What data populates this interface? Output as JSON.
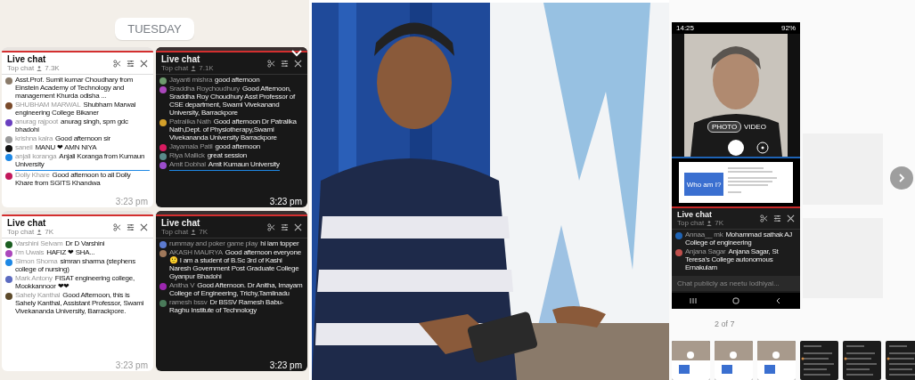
{
  "date_chip": "TUESDAY",
  "chat_screenshots": [
    {
      "dark": false,
      "title": "Live chat",
      "subtitle": "Top chat",
      "viewers": "7.3K",
      "time": "3:23 pm",
      "collapse_button": false,
      "messages": [
        {
          "text": "Asst.Prof. Sumit kumar Choudhary from Einstein Academy of Technology and management Khurda odisha ...",
          "color": "#8a7b6a",
          "underlined": false
        },
        {
          "author": "SHUBHAM MARWAL",
          "text": "Shubham Marwal engineering College Bikaner",
          "color": "#7a4a2a",
          "underlined": false
        },
        {
          "author": "anurag rajpoot",
          "text": "anurag singh, spm gdc bhadohi",
          "color": "#6a3fc0",
          "underlined": false
        },
        {
          "author": "krishna kalra",
          "text": "Good afternoon sir",
          "color": "#9a9a9a",
          "underlined": false
        },
        {
          "author": "saneil",
          "text": "MANU ❤ AMN NIYA",
          "color": "#111111",
          "underlined": false
        },
        {
          "author": "anjali koranga",
          "text": "Anjali Koranga from Kumaun University",
          "color": "#1e88e5",
          "underlined": true
        },
        {
          "author": "Dolly Khare",
          "text": "Good afternoon to all Dolly Khare from SGITS Khandwa",
          "color": "#c2185b",
          "underlined": false
        }
      ]
    },
    {
      "dark": true,
      "title": "Live chat",
      "subtitle": "Top chat",
      "viewers": "7.1K",
      "time": "3:23 pm",
      "collapse_button": true,
      "messages": [
        {
          "author": "Jayanti mishra",
          "text": "good afternoon",
          "color": "#6d9a6d",
          "underlined": false
        },
        {
          "author": "Sraddha Roychoudhury",
          "text": "Good Afternoon, Sraddha Roy Choudhury Asst Professor of CSE department, Swami Vivekanand University, Barrackpore",
          "color": "#ab47bc",
          "underlined": false
        },
        {
          "author": "Patralika Nath",
          "text": "Good afternoon Dr Patralika Nath,Dept. of Physiotherapy,Swami Vivekananda University Barrackpore",
          "color": "#d4a02a",
          "underlined": false
        },
        {
          "author": "Jayamala Patil",
          "text": "good afternoon",
          "color": "#d81b60",
          "underlined": false
        },
        {
          "author": "Riya Mallick",
          "text": "great session",
          "color": "#5a8a8a",
          "underlined": false
        },
        {
          "author": "Amit Dobhal",
          "text": "Amit Kumaun University",
          "color": "#9c4dcc",
          "underlined": true
        }
      ]
    },
    {
      "dark": false,
      "title": "Live chat",
      "subtitle": "Top chat",
      "viewers": "7K",
      "time": "3:23 pm",
      "collapse_button": false,
      "messages": [
        {
          "author": "Varshini Selvam",
          "text": "Dr D Varshini",
          "color": "#1b5e20",
          "underlined": false
        },
        {
          "author": "I'm Uwais",
          "text": "HAFIZ ❤ SHA...",
          "color": "#ab47bc",
          "underlined": false
        },
        {
          "author": "Simon Shoma",
          "text": "simran sharma (stephens college of nursing)",
          "color": "#1e88e5",
          "underlined": false
        },
        {
          "author": "Mark Antony",
          "text": "FISAT engineering college, Mookkannoor ❤❤",
          "color": "#5c6bc0",
          "underlined": false
        },
        {
          "author": "Sahely Kanthal",
          "text": "Good Afternoon, this is Sahely Kanthal, Assistant Professor, Swami Vivekananda University, Barrackpore.",
          "color": "#5d4a2a",
          "underlined": false
        }
      ]
    },
    {
      "dark": true,
      "title": "Live chat",
      "subtitle": "Top chat",
      "viewers": "7K",
      "time": "3:23 pm",
      "collapse_button": false,
      "messages": [
        {
          "author": "rummay and poker game play",
          "text": "hi iam topper",
          "color": "#5c7bd0",
          "underlined": false
        },
        {
          "author": "AKASH MAURYA",
          "text": "Good afternoon everyone 🙂 I am a student of B.Sc 3rd of Kashi Naresh Government Post Graduate College Gyanpur Bhadohi",
          "color": "#a0785a",
          "underlined": false
        },
        {
          "author": "Anitha V",
          "text": "Good Afternoon. Dr Anitha, Imayam College of Engineering, Trichy,Tamilnadu",
          "color": "#9c27b0",
          "underlined": false
        },
        {
          "author": "ramesh bssv",
          "text": "Dr BSSV Ramesh Babu- Raghu Institute of Technology",
          "color": "#4a7a5a",
          "underlined": false
        }
      ]
    }
  ],
  "viewer": {
    "phone": {
      "clock": "14:25",
      "battery": "92%",
      "camera_modes": [
        {
          "label": "PHOTO",
          "selected": true
        },
        {
          "label": "VIDEO",
          "selected": false
        }
      ],
      "slide_title": "Who am I?",
      "chat": {
        "title": "Live chat",
        "subtitle": "Top chat",
        "viewers": "7K",
        "messages": [
          {
            "author": "Annaa__ mk",
            "text": "Mohammad sathak AJ College of engineering",
            "color": "#1e63b5"
          },
          {
            "author": "Anjana Sagar",
            "text": "Anjana Sagar, St Teresa's College autonomous Ernakulam",
            "color": "#c0504d"
          }
        ],
        "placeholder": "Chat publicly as neetu lodhiyal..."
      }
    },
    "counter": "2 of 7",
    "thumbnails": [
      {
        "kind": "camera"
      },
      {
        "kind": "camera"
      },
      {
        "kind": "camera"
      },
      {
        "kind": "chat"
      },
      {
        "kind": "chat"
      },
      {
        "kind": "chat"
      }
    ]
  }
}
